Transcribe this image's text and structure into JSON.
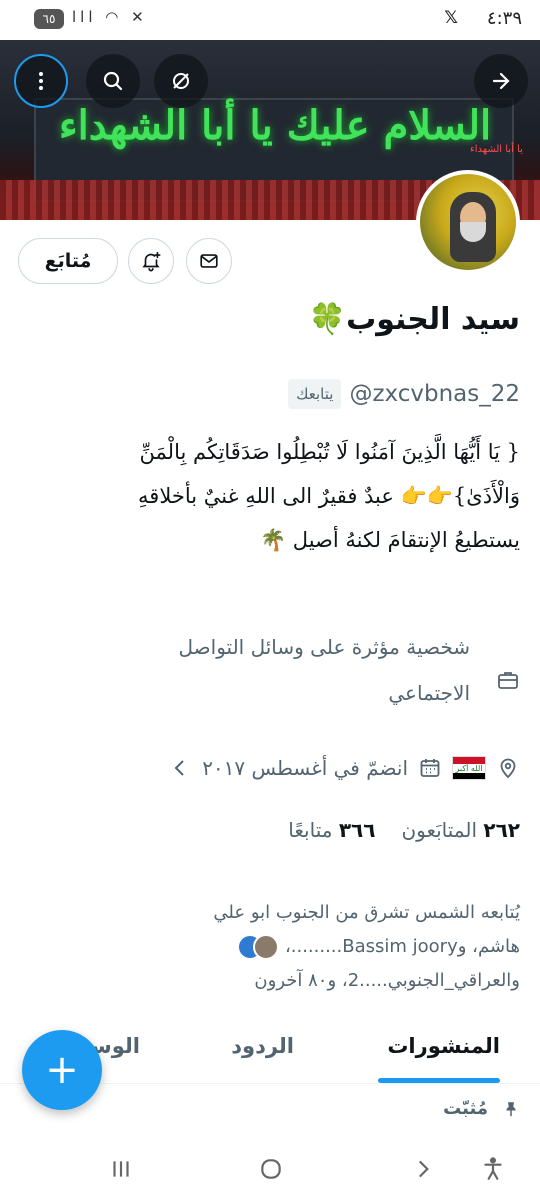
{
  "status_bar": {
    "time": "٤:٣٩",
    "x_badge": "𝕏",
    "battery": "٦٥",
    "icons": "lll ◠ ✕"
  },
  "banner": {
    "headline": "السلام عليك يا أبا الشهداء",
    "sub": "يا أبا الشهداء"
  },
  "top_buttons": {
    "back": "back-arrow-icon",
    "grok": "grok-icon",
    "search": "search-icon",
    "more": "more-vertical-icon"
  },
  "actions": {
    "follow_label": "مُتابَع",
    "notify_icon": "bell-plus-icon",
    "message_icon": "mail-icon"
  },
  "profile": {
    "name": "سيد الجنوب🍀",
    "handle": "@zxcvbnas_22",
    "follows_you": "يتابعك",
    "bio_lines": [
      "{ يَا أَيُّهَا الَّذِينَ آمَنُوا لَا تُبْطِلُوا صَدَقَاتِكُم بِالْمَنِّ",
      "وَالْأَذَىٰ}👉👉 عبدٌ فقيرٌ الى اللهِ غنيٌ بأخلاقهِ",
      "يستطيعُ الإنتقامَ لكنهُ أصيل 🌴"
    ],
    "category_lines": [
      "شخصية مؤثرة على وسائل التواصل",
      "الاجتماعي"
    ],
    "location_flag": "Iraq",
    "flag_text": "الله أكبر",
    "joined": "انضمّ في أغسطس ٢٠١٧",
    "followers_count": "٢٦٢",
    "followers_label": "المتابَعون",
    "following_count": "٣٦٦",
    "following_label": "متابعًا",
    "known_followers_line1": "يُتابعه الشمس تشرق من الجنوب ابو علي",
    "known_followers_line2": "هاشم، وBassim joory.........،",
    "known_followers_line3": "والعراقي_الجنوبي.....2، و٨٠ آخرون"
  },
  "tabs": {
    "posts": "المنشورات",
    "replies": "الردود",
    "media": "الوس"
  },
  "pinned_label": "مُثبّت",
  "fab_label": "+",
  "colors": {
    "accent": "#1d9bf0",
    "text": "#0f1419",
    "muted": "#536471"
  }
}
